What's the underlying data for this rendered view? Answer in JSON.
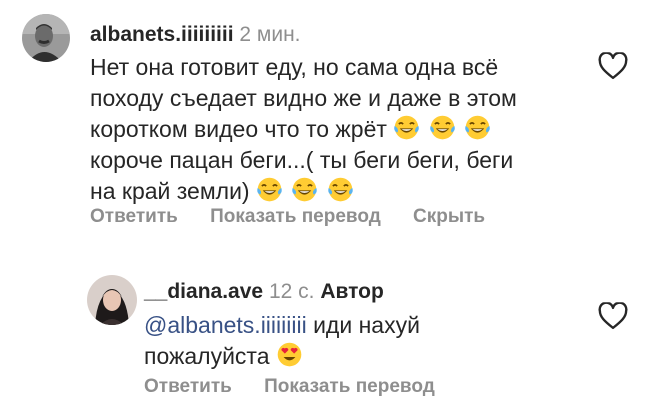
{
  "comments": [
    {
      "username": "albanets.iiiiiiiii",
      "time": "2 мин.",
      "text_line1": "Нет она готовит еду, но сама одна всё",
      "text_line2": "походу съедает видно же и даже в этом",
      "text_line3": "коротком видео что то жрёт",
      "text_line4": "короче пацан беги...( ты беги беги, беги",
      "text_line5": "на край земли)",
      "actions": [
        "Ответить",
        "Показать перевод",
        "Скрыть"
      ]
    },
    {
      "username": "__diana.ave",
      "time": "12 с.",
      "author_tag": "Автор",
      "mention": "@albanets.iiiiiiiii",
      "text_line1_rest": " иди нахуй",
      "text_line2": "пожалуйста",
      "actions": [
        "Ответить",
        "Показать перевод"
      ]
    }
  ],
  "icons": {
    "heart": "heart-outline-icon",
    "laughing": "face-with-tears-of-joy-emoji",
    "heart_eyes": "smiling-face-with-heart-eyes-emoji"
  },
  "colors": {
    "text": "#262626",
    "secondary": "#8e8e8e",
    "mention": "#385185",
    "emoji_face": "#ffcc33",
    "emoji_tear": "#5ab4f0",
    "emoji_heart": "#e8223b"
  }
}
